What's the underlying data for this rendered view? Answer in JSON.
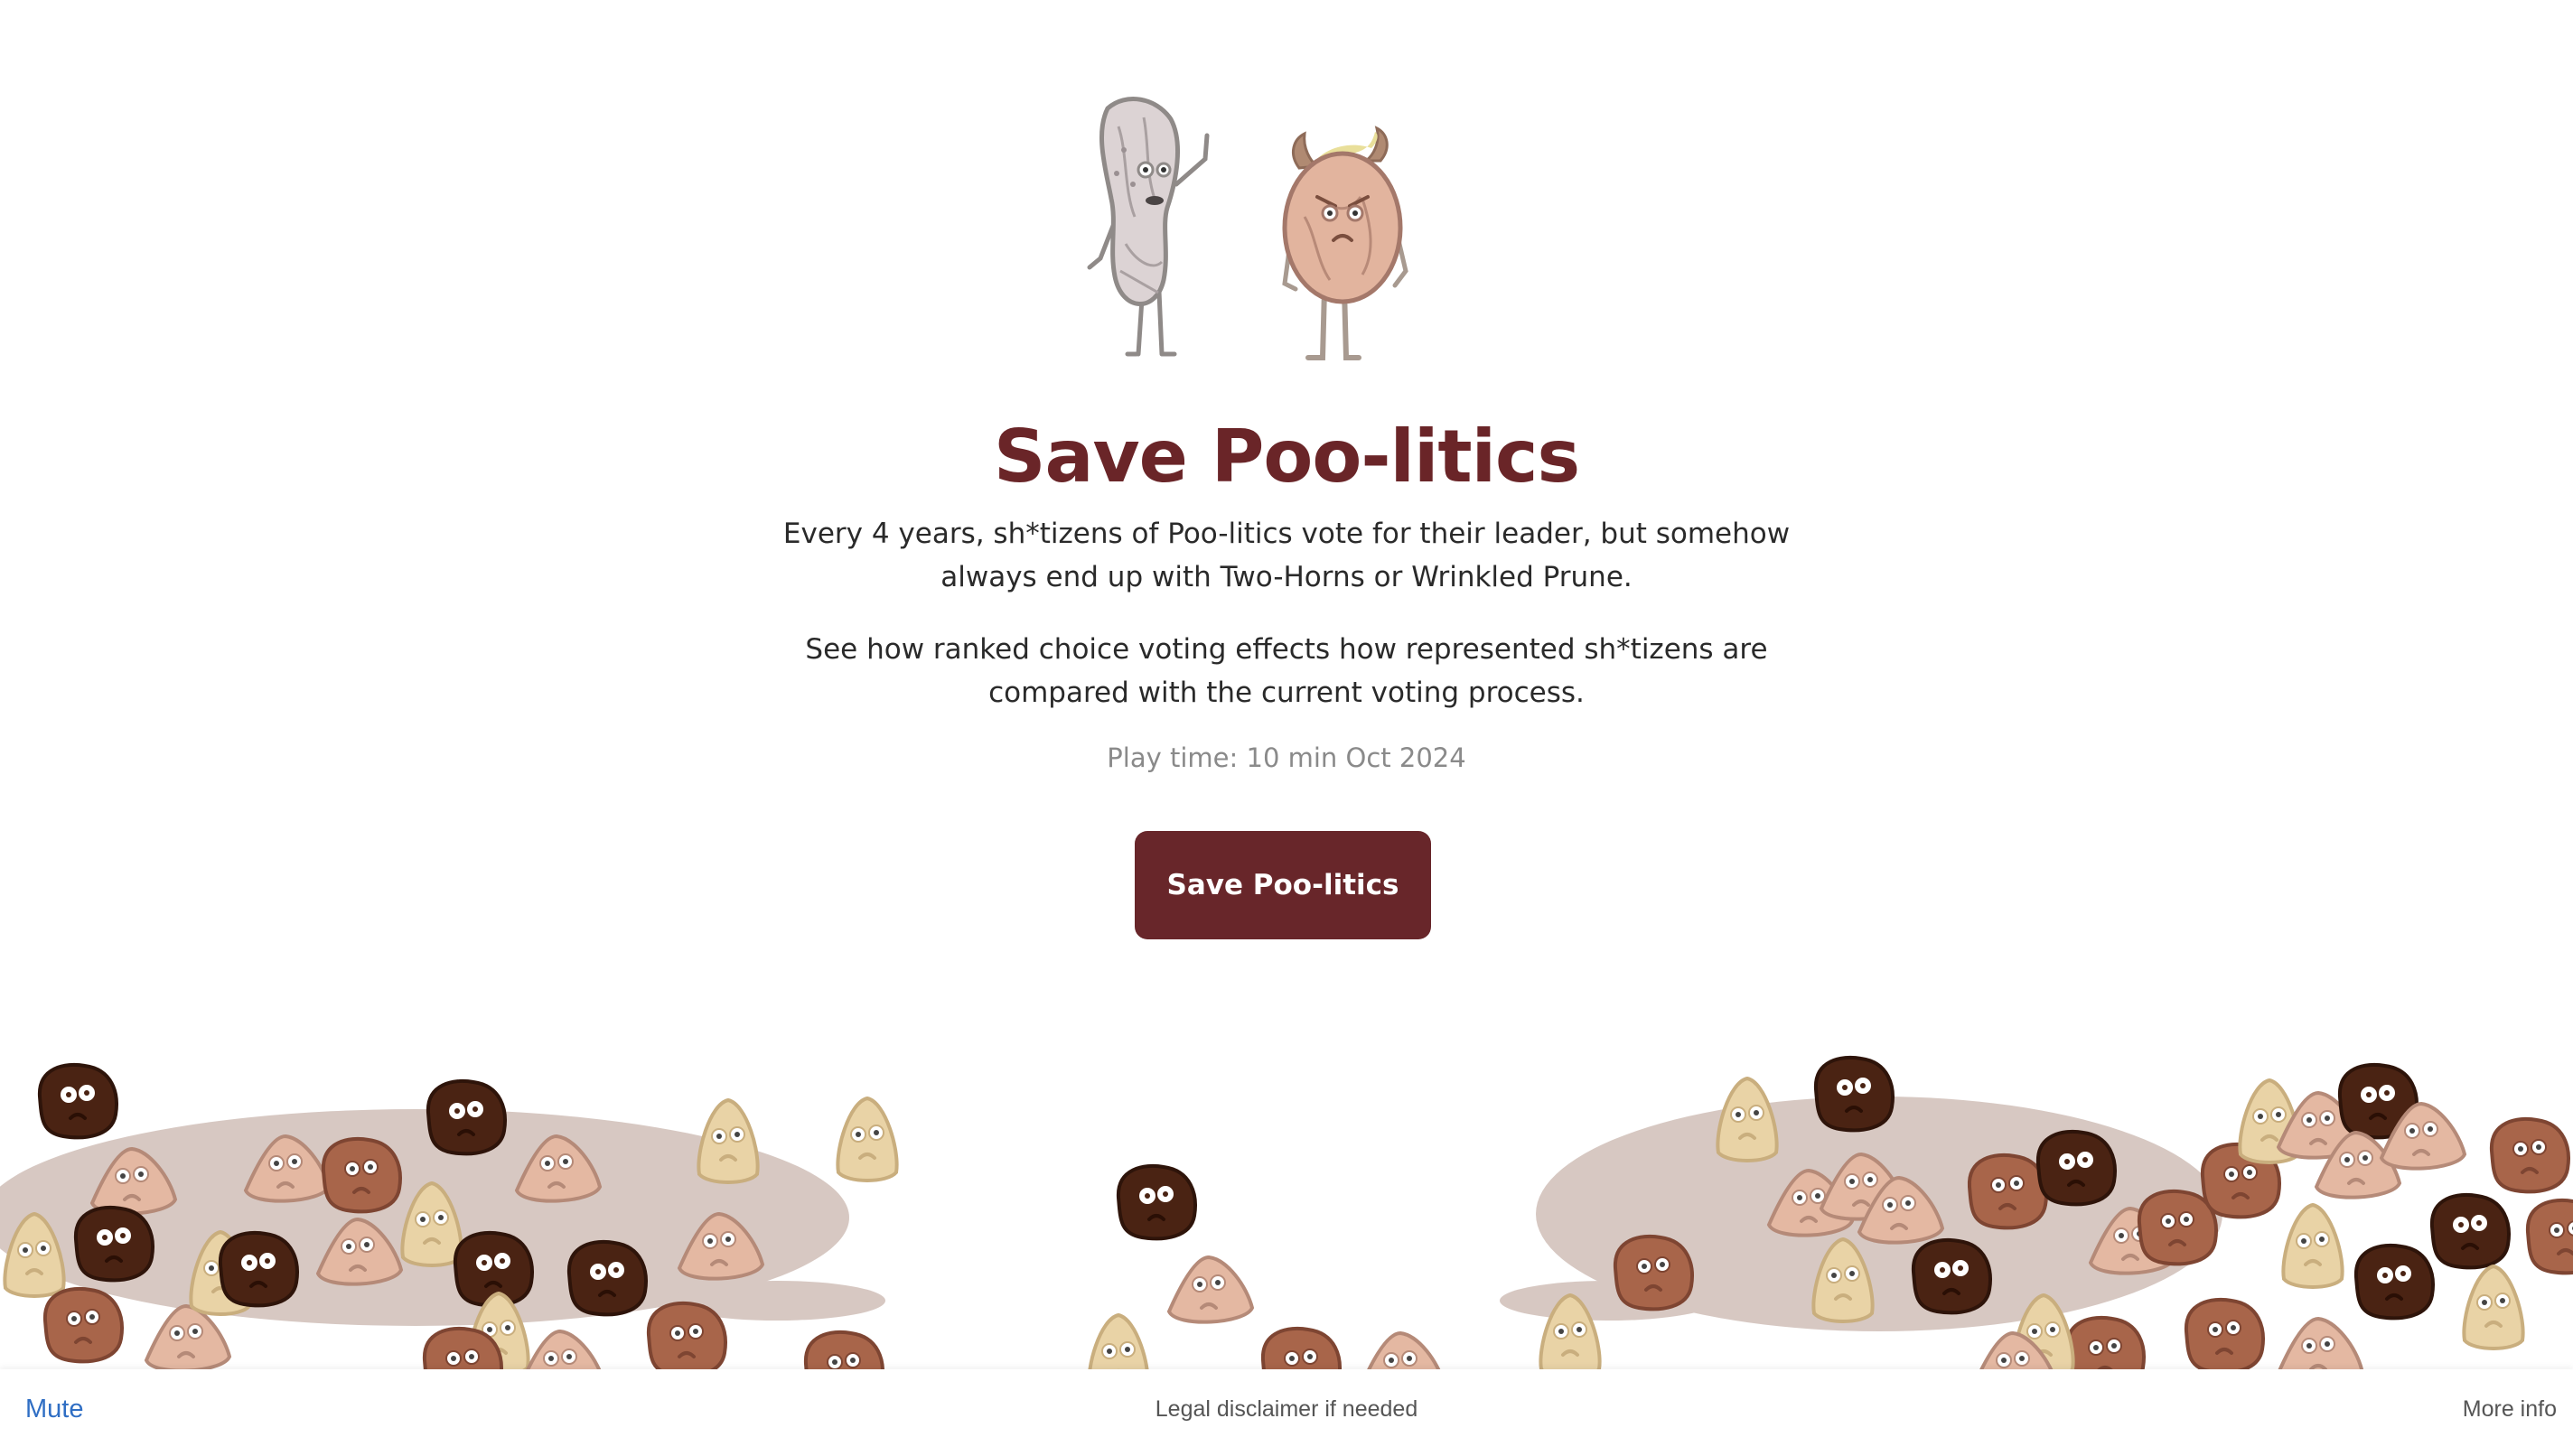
{
  "hero": {
    "characters": [
      "wrinkled-prune-character",
      "two-horns-character"
    ],
    "title": "Save Poo-litics",
    "intro": [
      "Every 4 years, sh*tizens of Poo-litics vote for their leader, but somehow always end up with Two-Horns or Wrinkled Prune.",
      "See how ranked choice voting effects how represented sh*tizens are compared with the current voting process."
    ],
    "meta": "Play time: 10 min Oct 2024",
    "cta_label": "Save Poo-litics"
  },
  "colors": {
    "title": "#6a2528",
    "button": "#68262a",
    "puddle": "#d7c8c2",
    "link": "#2f6ec4",
    "citizens": [
      "#4a2313",
      "#a8654a",
      "#e4b8a2",
      "#e9d3a6"
    ]
  },
  "footer": {
    "mute_label": "Mute",
    "legal": "Legal disclaimer if needed",
    "more_label": "More info"
  }
}
